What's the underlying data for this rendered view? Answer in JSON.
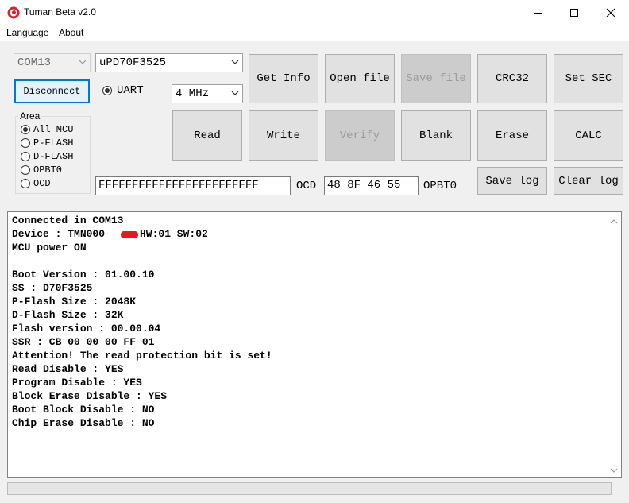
{
  "window": {
    "title": "Tuman Beta v2.0"
  },
  "menu": [
    "Language",
    "About"
  ],
  "port": {
    "value": "COM13",
    "connect_label": "Disconnect"
  },
  "mcu": {
    "value": "uPD70F3525"
  },
  "interface": {
    "label": "UART",
    "selected": true
  },
  "frequency": {
    "value": "4 MHz"
  },
  "area": {
    "title": "Area",
    "options": [
      "All MCU",
      "P-FLASH",
      "D-FLASH",
      "OPBT0",
      "OCD"
    ],
    "selected": "All MCU"
  },
  "buttons": {
    "get_info": "Get Info",
    "open_file": "Open file",
    "save_file": "Save file",
    "crc32": "CRC32",
    "set_sec": "Set SEC",
    "read": "Read",
    "write": "Write",
    "verify": "Verify",
    "blank": "Blank",
    "erase": "Erase",
    "calc": "CALC",
    "save_log": "Save log",
    "clear_log": "Clear log"
  },
  "ocd": {
    "value": "FFFFFFFFFFFFFFFFFFFFFFFF",
    "label": "OCD"
  },
  "opbt": {
    "value": "48 8F 46 55",
    "label": "OPBT0"
  },
  "log": [
    "Connected in COM13",
    "Device : TMN000",
    "MCU power ON",
    "",
    "Boot Version : 01.00.10",
    "SS : D70F3525",
    "P-Flash Size : 2048K",
    "D-Flash Size : 32K",
    "Flash version : 00.00.04",
    "SSR : CB 00 00 00 FF 01",
    "Attention! The read protection bit is set!",
    "Read Disable : YES",
    "Program Disable : YES",
    "Block Erase Disable : YES",
    "Boot Block Disable : NO",
    "Chip Erase Disable : NO"
  ],
  "log_device_suffix": "HW:01 SW:02",
  "colors": {
    "accent": "#0078d7",
    "redaction": "#e8191e",
    "app_icon": "#d9242c"
  },
  "icons": [
    "app-icon",
    "minimize-icon",
    "maximize-icon",
    "close-icon",
    "chevron-down-icon",
    "scroll-up-icon",
    "scroll-down-icon"
  ]
}
